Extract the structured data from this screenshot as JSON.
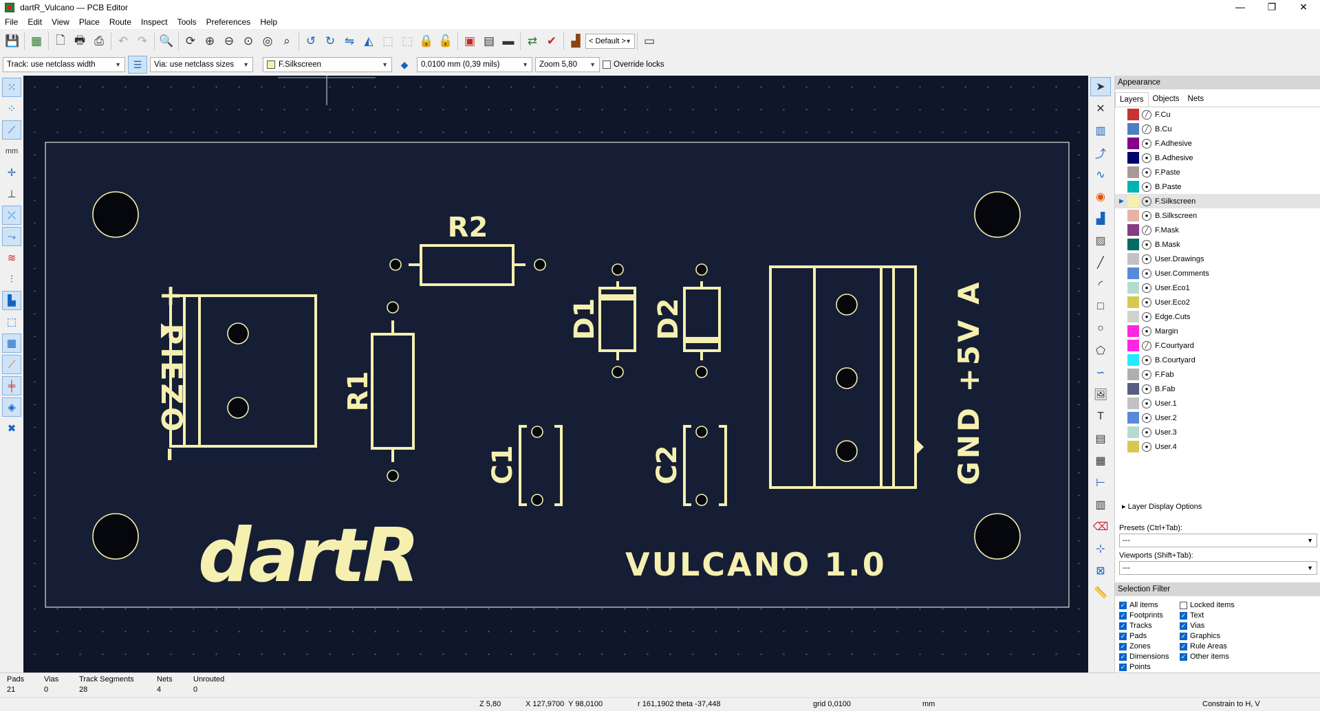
{
  "window": {
    "title": "dartR_Vulcano — PCB Editor",
    "minimize": "—",
    "maximize": "❐",
    "close": "✕"
  },
  "menu": [
    "File",
    "Edit",
    "View",
    "Place",
    "Route",
    "Inspect",
    "Tools",
    "Preferences",
    "Help"
  ],
  "toolbar": {
    "layer_preset": "< Default >"
  },
  "options": {
    "track": "Track: use netclass width",
    "via": "Via: use netclass sizes",
    "layer": "F.Silkscreen",
    "layer_color": "#f5f0b0",
    "grid": "0,0100 mm (0,39 mils)",
    "zoom": "Zoom 5,80",
    "override_locks": "Override locks"
  },
  "board": {
    "piezo_label": "+ PIEZO –",
    "power_label": "GND +5V A",
    "logo": "dartR",
    "version_text": "VULCANO 1.0",
    "refs": {
      "r1": "R1",
      "r2": "R2",
      "d1": "D1",
      "d2": "D2",
      "c1": "C1",
      "c2": "C2"
    },
    "silk_color": "#f5f0b0",
    "background": "#0f1629"
  },
  "appearance": {
    "title": "Appearance",
    "tabs": [
      "Layers",
      "Objects",
      "Nets"
    ],
    "layers": [
      {
        "name": "F.Cu",
        "color": "#c83434",
        "visible": false
      },
      {
        "name": "B.Cu",
        "color": "#4d7fc4",
        "visible": false
      },
      {
        "name": "F.Adhesive",
        "color": "#84008a",
        "visible": true
      },
      {
        "name": "B.Adhesive",
        "color": "#00006e",
        "visible": true
      },
      {
        "name": "F.Paste",
        "color": "#a89a9a",
        "visible": true
      },
      {
        "name": "B.Paste",
        "color": "#00b2b2",
        "visible": true
      },
      {
        "name": "F.Silkscreen",
        "color": "#f5f0b0",
        "visible": true,
        "active": true
      },
      {
        "name": "B.Silkscreen",
        "color": "#e8b2a7",
        "visible": true
      },
      {
        "name": "F.Mask",
        "color": "#843c84",
        "visible": false
      },
      {
        "name": "B.Mask",
        "color": "#026b63",
        "visible": true
      },
      {
        "name": "User.Drawings",
        "color": "#c2c2c2",
        "visible": true
      },
      {
        "name": "User.Comments",
        "color": "#5989db",
        "visible": true
      },
      {
        "name": "User.Eco1",
        "color": "#b4dbd2",
        "visible": true
      },
      {
        "name": "User.Eco2",
        "color": "#d8c852",
        "visible": true
      },
      {
        "name": "Edge.Cuts",
        "color": "#d0d2cd",
        "visible": true
      },
      {
        "name": "Margin",
        "color": "#ff26e2",
        "visible": true
      },
      {
        "name": "F.Courtyard",
        "color": "#ff26e2",
        "visible": false
      },
      {
        "name": "B.Courtyard",
        "color": "#26e9ff",
        "visible": true
      },
      {
        "name": "F.Fab",
        "color": "#afafaf",
        "visible": true
      },
      {
        "name": "B.Fab",
        "color": "#585d84",
        "visible": true
      },
      {
        "name": "User.1",
        "color": "#c2c2c2",
        "visible": true
      },
      {
        "name": "User.2",
        "color": "#5989db",
        "visible": true
      },
      {
        "name": "User.3",
        "color": "#b4dbd2",
        "visible": true
      },
      {
        "name": "User.4",
        "color": "#d8c852",
        "visible": true
      }
    ],
    "layer_display_options": "Layer Display Options",
    "presets_label": "Presets (Ctrl+Tab):",
    "presets_value": "---",
    "viewports_label": "Viewports (Shift+Tab):",
    "viewports_value": "---"
  },
  "selection_filter": {
    "title": "Selection Filter",
    "items": [
      {
        "label": "All items",
        "checked": true
      },
      {
        "label": "Locked items",
        "checked": false
      },
      {
        "label": "Footprints",
        "checked": true
      },
      {
        "label": "Text",
        "checked": true
      },
      {
        "label": "Tracks",
        "checked": true
      },
      {
        "label": "Vias",
        "checked": true
      },
      {
        "label": "Pads",
        "checked": true
      },
      {
        "label": "Graphics",
        "checked": true
      },
      {
        "label": "Zones",
        "checked": true
      },
      {
        "label": "Rule Areas",
        "checked": true
      },
      {
        "label": "Dimensions",
        "checked": true
      },
      {
        "label": "Other items",
        "checked": true
      },
      {
        "label": "Points",
        "checked": true
      }
    ]
  },
  "stats": {
    "pads_label": "Pads",
    "pads": "21",
    "vias_label": "Vias",
    "vias": "0",
    "tracks_label": "Track Segments",
    "tracks": "28",
    "nets_label": "Nets",
    "nets": "4",
    "unrouted_label": "Unrouted",
    "unrouted": "0"
  },
  "status": {
    "zoom": "Z 5,80",
    "xy": "X 127,9700  Y 98,0100",
    "polar": "r 161,1902  theta -37,448",
    "grid": "grid 0,0100",
    "units": "mm",
    "constraint": "Constrain to H, V"
  }
}
